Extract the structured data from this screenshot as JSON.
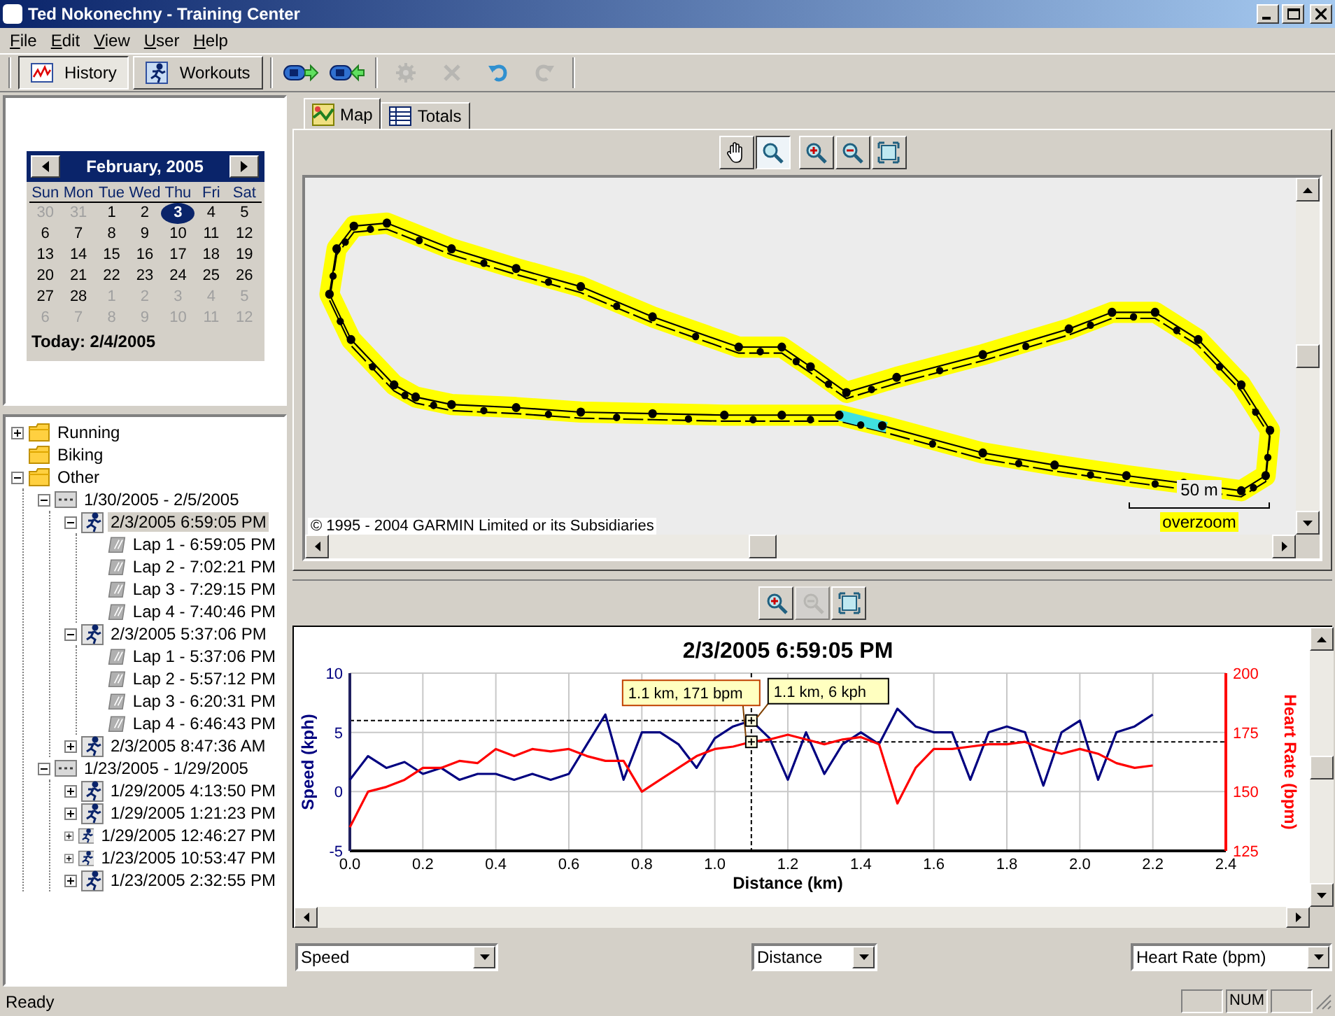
{
  "window": {
    "title": "Ted Nokonechny - Training Center"
  },
  "menu": [
    "File",
    "Edit",
    "View",
    "User",
    "Help"
  ],
  "toolbar": {
    "views": [
      {
        "label": "History",
        "selected": true
      },
      {
        "label": "Workouts",
        "selected": false
      }
    ],
    "actions": [
      {
        "kind": "send",
        "disabled": false
      },
      {
        "kind": "receive",
        "disabled": false
      },
      {
        "kind": "gear",
        "disabled": true
      },
      {
        "kind": "delete",
        "disabled": true
      },
      {
        "kind": "undo",
        "disabled": false
      },
      {
        "kind": "redo",
        "disabled": true
      }
    ]
  },
  "calendar": {
    "month": "February, 2005",
    "weekdays": [
      "Sun",
      "Mon",
      "Tue",
      "Wed",
      "Thu",
      "Fri",
      "Sat"
    ],
    "weeks": [
      [
        {
          "day": "30",
          "muted": true,
          "selected": false
        },
        {
          "day": "31",
          "muted": true,
          "selected": false
        },
        {
          "day": "1",
          "muted": false,
          "selected": false
        },
        {
          "day": "2",
          "muted": false,
          "selected": false
        },
        {
          "day": "3",
          "muted": false,
          "selected": true
        },
        {
          "day": "4",
          "muted": false,
          "selected": false
        },
        {
          "day": "5",
          "muted": false,
          "selected": false
        }
      ],
      [
        {
          "day": "6",
          "muted": false,
          "selected": false
        },
        {
          "day": "7",
          "muted": false,
          "selected": false
        },
        {
          "day": "8",
          "muted": false,
          "selected": false
        },
        {
          "day": "9",
          "muted": false,
          "selected": false
        },
        {
          "day": "10",
          "muted": false,
          "selected": false
        },
        {
          "day": "11",
          "muted": false,
          "selected": false
        },
        {
          "day": "12",
          "muted": false,
          "selected": false
        }
      ],
      [
        {
          "day": "13",
          "muted": false,
          "selected": false
        },
        {
          "day": "14",
          "muted": false,
          "selected": false
        },
        {
          "day": "15",
          "muted": false,
          "selected": false
        },
        {
          "day": "16",
          "muted": false,
          "selected": false
        },
        {
          "day": "17",
          "muted": false,
          "selected": false
        },
        {
          "day": "18",
          "muted": false,
          "selected": false
        },
        {
          "day": "19",
          "muted": false,
          "selected": false
        }
      ],
      [
        {
          "day": "20",
          "muted": false,
          "selected": false
        },
        {
          "day": "21",
          "muted": false,
          "selected": false
        },
        {
          "day": "22",
          "muted": false,
          "selected": false
        },
        {
          "day": "23",
          "muted": false,
          "selected": false
        },
        {
          "day": "24",
          "muted": false,
          "selected": false
        },
        {
          "day": "25",
          "muted": false,
          "selected": false
        },
        {
          "day": "26",
          "muted": false,
          "selected": false
        }
      ],
      [
        {
          "day": "27",
          "muted": false,
          "selected": false
        },
        {
          "day": "28",
          "muted": false,
          "selected": false
        },
        {
          "day": "1",
          "muted": true,
          "selected": false
        },
        {
          "day": "2",
          "muted": true,
          "selected": false
        },
        {
          "day": "3",
          "muted": true,
          "selected": false
        },
        {
          "day": "4",
          "muted": true,
          "selected": false
        },
        {
          "day": "5",
          "muted": true,
          "selected": false
        }
      ],
      [
        {
          "day": "6",
          "muted": true,
          "selected": false
        },
        {
          "day": "7",
          "muted": true,
          "selected": false
        },
        {
          "day": "8",
          "muted": true,
          "selected": false
        },
        {
          "day": "9",
          "muted": true,
          "selected": false
        },
        {
          "day": "10",
          "muted": true,
          "selected": false
        },
        {
          "day": "11",
          "muted": true,
          "selected": false
        },
        {
          "day": "12",
          "muted": true,
          "selected": false
        }
      ]
    ],
    "today": "Today: 2/4/2005"
  },
  "tree": [
    {
      "label": "Running",
      "kind": "folder",
      "expanded": false,
      "selected": false
    },
    {
      "label": "Biking",
      "kind": "folder",
      "selected": false
    },
    {
      "label": "Other",
      "kind": "folder",
      "expanded": true,
      "selected": false,
      "children": [
        {
          "label": "1/30/2005 - 2/5/2005",
          "kind": "week",
          "expanded": true,
          "selected": false,
          "children": [
            {
              "label": "2/3/2005 6:59:05 PM",
              "kind": "activity",
              "expanded": true,
              "selected": true,
              "children": [
                {
                  "label": "Lap 1 - 6:59:05 PM",
                  "kind": "lap",
                  "selected": false
                },
                {
                  "label": "Lap 2 - 7:02:21 PM",
                  "kind": "lap",
                  "selected": false
                },
                {
                  "label": "Lap 3 - 7:29:15 PM",
                  "kind": "lap",
                  "selected": false
                },
                {
                  "label": "Lap 4 - 7:40:46 PM",
                  "kind": "lap",
                  "selected": false
                }
              ]
            },
            {
              "label": "2/3/2005 5:37:06 PM",
              "kind": "activity",
              "expanded": true,
              "selected": false,
              "children": [
                {
                  "label": "Lap 1 - 5:37:06 PM",
                  "kind": "lap",
                  "selected": false
                },
                {
                  "label": "Lap 2 - 5:57:12 PM",
                  "kind": "lap",
                  "selected": false
                },
                {
                  "label": "Lap 3 - 6:20:31 PM",
                  "kind": "lap",
                  "selected": false
                },
                {
                  "label": "Lap 4 - 6:46:43 PM",
                  "kind": "lap",
                  "selected": false
                }
              ]
            },
            {
              "label": "2/3/2005 8:47:36 AM",
              "kind": "activity",
              "expanded": false,
              "selected": false
            }
          ]
        },
        {
          "label": "1/23/2005 - 1/29/2005",
          "kind": "week",
          "expanded": true,
          "selected": false,
          "children": [
            {
              "label": "1/29/2005 4:13:50 PM",
              "kind": "activity",
              "expanded": false,
              "selected": false
            },
            {
              "label": "1/29/2005 1:21:23 PM",
              "kind": "activity",
              "expanded": false,
              "selected": false
            },
            {
              "label": "1/29/2005 12:46:27 PM",
              "kind": "activity",
              "expanded": false,
              "selected": false
            },
            {
              "label": "1/23/2005 10:53:47 PM",
              "kind": "activity",
              "expanded": false,
              "selected": false
            },
            {
              "label": "1/23/2005 2:32:55 PM",
              "kind": "activity",
              "expanded": false,
              "selected": false
            }
          ]
        }
      ]
    }
  ],
  "map": {
    "tabs": [
      {
        "label": "Map",
        "selected": true
      },
      {
        "label": "Totals",
        "selected": false
      }
    ],
    "tools": [
      [
        {
          "kind": "pan",
          "selected": false
        },
        {
          "kind": "zoom",
          "selected": true
        }
      ],
      [
        {
          "kind": "zoom_in",
          "selected": false
        },
        {
          "kind": "zoom_out",
          "selected": false
        },
        {
          "kind": "fit",
          "selected": false
        }
      ]
    ],
    "copyright": "© 1995 - 2004 GARMIN Limited or its Subsidiaries",
    "scale": "50 m",
    "zoom_note": "overzoom"
  },
  "graph": {
    "tools": [
      {
        "kind": "zoom_in",
        "disabled": false
      },
      {
        "kind": "zoom_out",
        "disabled": true
      },
      {
        "kind": "fit",
        "disabled": false
      }
    ],
    "chart_data": {
      "type": "line",
      "title": "2/3/2005 6:59:05 PM",
      "xlabel": "Distance (km)",
      "ylabel": "Speed (kph)",
      "y2label": "Heart Rate (bpm)",
      "x": [
        0,
        0.05,
        0.1,
        0.15,
        0.2,
        0.25,
        0.3,
        0.35,
        0.4,
        0.45,
        0.5,
        0.55,
        0.6,
        0.65,
        0.7,
        0.75,
        0.8,
        0.85,
        0.9,
        0.95,
        1.0,
        1.05,
        1.1,
        1.15,
        1.2,
        1.25,
        1.3,
        1.35,
        1.4,
        1.45,
        1.5,
        1.55,
        1.6,
        1.65,
        1.7,
        1.75,
        1.8,
        1.85,
        1.9,
        1.95,
        2.0,
        2.05,
        2.1,
        2.15,
        2.2
      ],
      "series": [
        {
          "color": "#000080",
          "values": [
            1,
            3,
            2,
            2.5,
            1.5,
            2,
            1,
            1.5,
            1.5,
            1,
            1.5,
            1,
            1.5,
            4,
            6.5,
            1,
            5,
            5,
            4,
            2,
            4.5,
            5.5,
            6,
            4.5,
            1,
            5,
            1.5,
            4,
            5,
            4,
            7,
            5.5,
            5,
            5,
            1,
            5,
            5.5,
            5,
            0.5,
            5,
            6,
            1,
            5,
            5.5,
            6.5
          ]
        },
        {
          "color": "#ff0000",
          "axis": "y2",
          "values": [
            135,
            150,
            152,
            155,
            160,
            160,
            163,
            162,
            168,
            165,
            168,
            167,
            168,
            165,
            163,
            163,
            150,
            155,
            160,
            165,
            168,
            169,
            171,
            172,
            174,
            172,
            170,
            172,
            173,
            170,
            145,
            160,
            168,
            168,
            169,
            170,
            170,
            171,
            168,
            166,
            168,
            166,
            162,
            160,
            161
          ]
        }
      ],
      "xlim": [
        0,
        2.4
      ],
      "ylim": [
        -5,
        10
      ],
      "y2lim": [
        125,
        200
      ],
      "xticks": [
        {
          "value": 0,
          "label": "0.0"
        },
        {
          "value": 0.2,
          "label": "0.2"
        },
        {
          "value": 0.4,
          "label": "0.4"
        },
        {
          "value": 0.6,
          "label": "0.6"
        },
        {
          "value": 0.8,
          "label": "0.8"
        },
        {
          "value": 1,
          "label": "1.0"
        },
        {
          "value": 1.2,
          "label": "1.2"
        },
        {
          "value": 1.4,
          "label": "1.4"
        },
        {
          "value": 1.6,
          "label": "1.6"
        },
        {
          "value": 1.8,
          "label": "1.8"
        },
        {
          "value": 2,
          "label": "2.0"
        },
        {
          "value": 2.2,
          "label": "2.2"
        },
        {
          "value": 2.4,
          "label": "2.4"
        }
      ],
      "yticks": [
        -5,
        0,
        5,
        10
      ],
      "y2ticks": [
        125,
        150,
        175,
        200
      ],
      "grid": true,
      "ref_lines": [
        {
          "axis": "x",
          "value": 1.1
        },
        {
          "axis": "y",
          "value": 6
        },
        {
          "axis": "y",
          "value": 4.2
        }
      ],
      "annotations": [
        {
          "text": "1.1 km, 171 bpm",
          "x": 1.1,
          "y": 4.2
        },
        {
          "text": "1.1 km, 6 kph",
          "x": 1.1,
          "y": 6
        }
      ]
    },
    "selectors": [
      "Speed",
      "Distance",
      "Heart Rate (bpm)"
    ]
  },
  "status_bar": {
    "text": "Ready",
    "indicator": "NUM"
  }
}
